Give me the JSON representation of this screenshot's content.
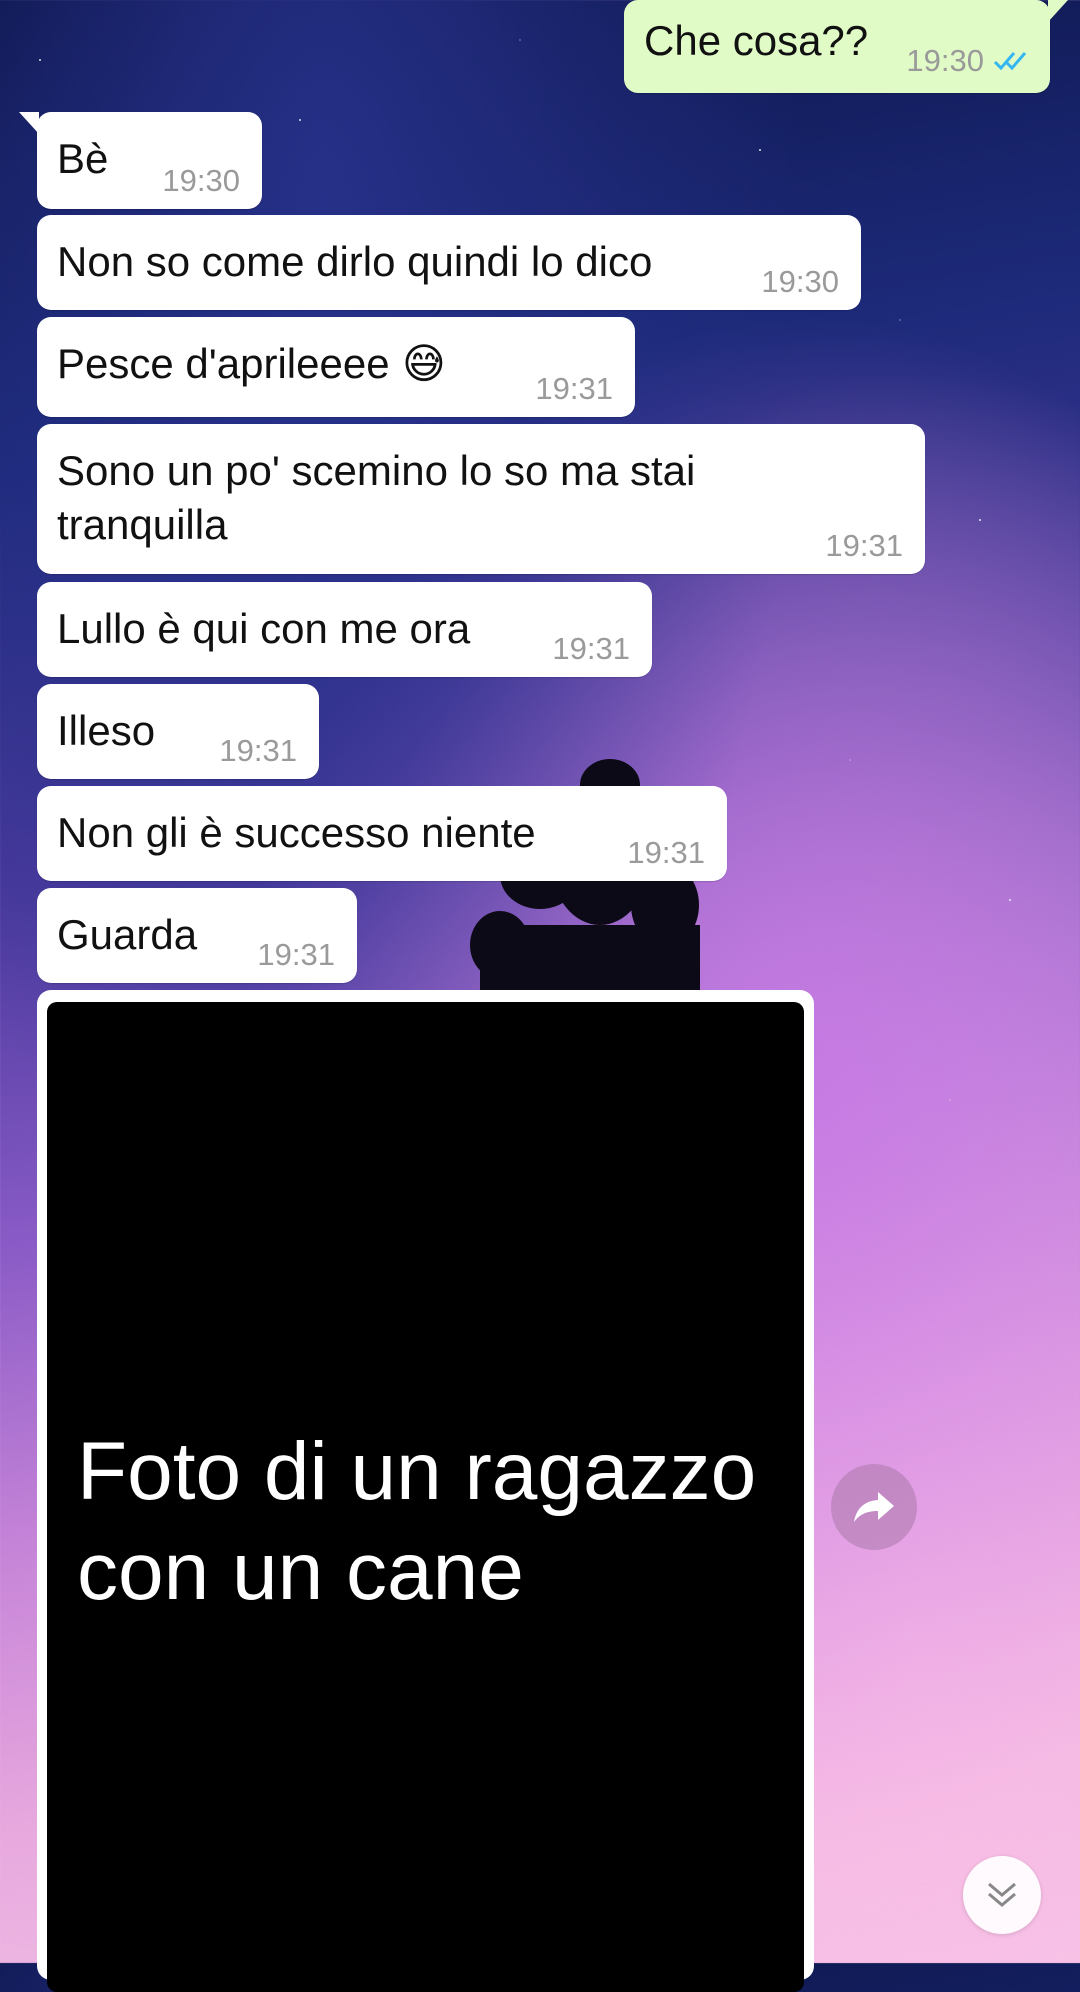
{
  "messages": [
    {
      "text": "Che cosa??",
      "time": "19:30",
      "direction": "outgoing",
      "status": "read"
    },
    {
      "text": "Bè",
      "time": "19:30",
      "direction": "incoming"
    },
    {
      "text": "Non so come dirlo quindi lo dico",
      "time": "19:30",
      "direction": "incoming"
    },
    {
      "text": "Pesce d'aprileeee",
      "emoji": "😅",
      "time": "19:31",
      "direction": "incoming"
    },
    {
      "text": "Sono un po' scemino lo so ma stai tranquilla",
      "time": "19:31",
      "direction": "incoming"
    },
    {
      "text": "Lullo è qui con me ora",
      "time": "19:31",
      "direction": "incoming"
    },
    {
      "text": "Illeso",
      "time": "19:31",
      "direction": "incoming"
    },
    {
      "text": "Non gli è successo niente",
      "time": "19:31",
      "direction": "incoming"
    },
    {
      "text": "Guarda",
      "time": "19:31",
      "direction": "incoming"
    }
  ],
  "media": {
    "caption": "Foto di un ragazzo con un cane"
  },
  "icons": {
    "read_ticks": "double-check-icon",
    "share": "share-forward-icon",
    "scroll_down": "chevron-double-down-icon"
  },
  "colors": {
    "outgoing_bubble": "#e1fbc6",
    "incoming_bubble": "#ffffff",
    "read_ticks": "#34b7f1",
    "timestamp": "#9a9a9a"
  }
}
